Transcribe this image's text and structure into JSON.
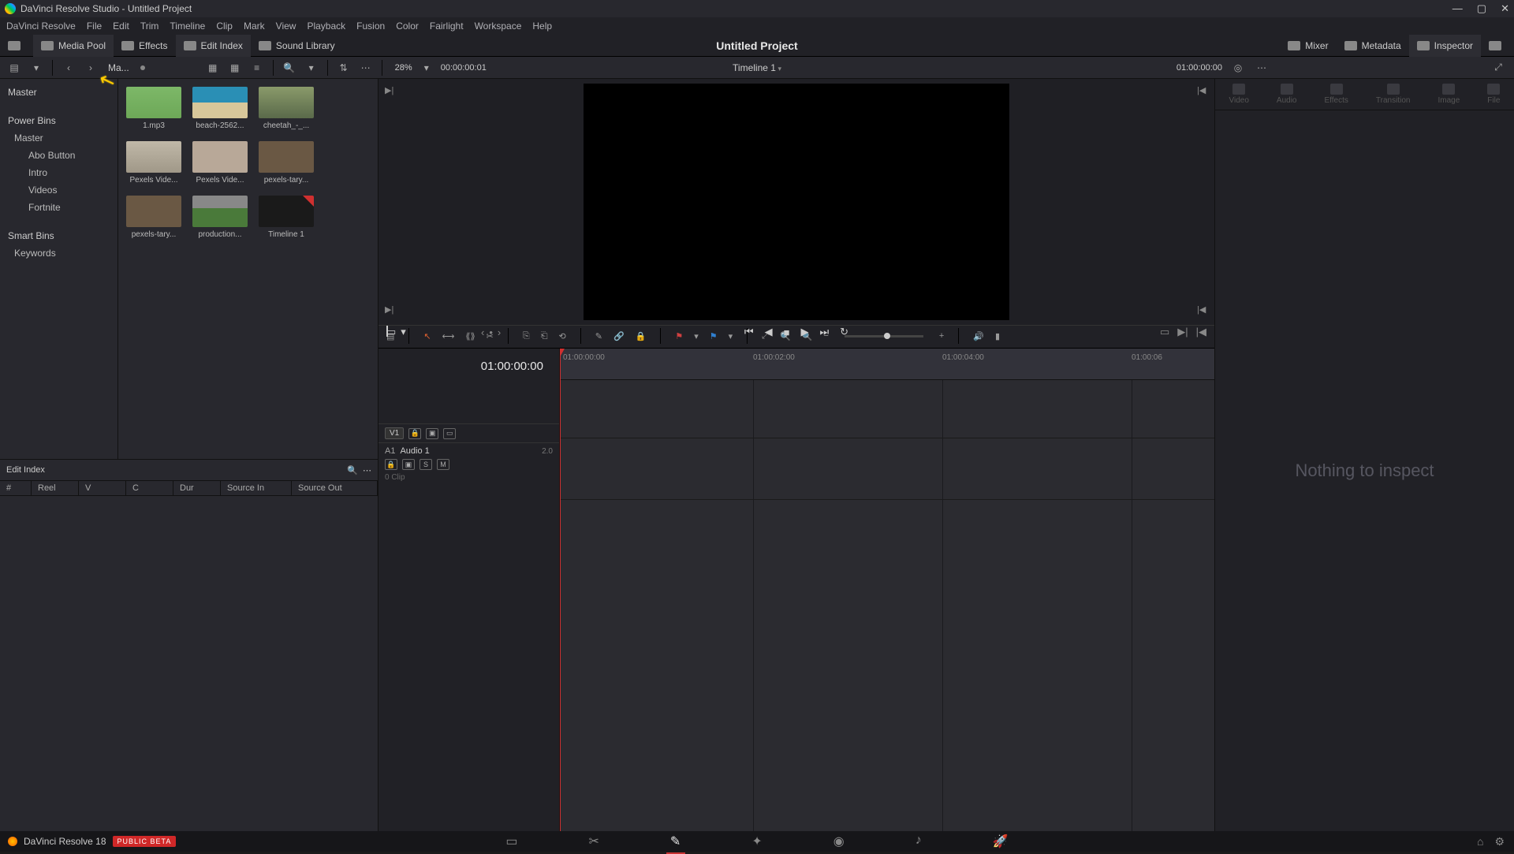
{
  "titlebar": {
    "text": "DaVinci Resolve Studio - Untitled Project"
  },
  "menubar": [
    "DaVinci Resolve",
    "File",
    "Edit",
    "Trim",
    "Timeline",
    "Clip",
    "Mark",
    "View",
    "Playback",
    "Fusion",
    "Color",
    "Fairlight",
    "Workspace",
    "Help"
  ],
  "toolbar": {
    "mediaPool": "Media Pool",
    "effects": "Effects",
    "editIndex": "Edit Index",
    "soundLibrary": "Sound Library",
    "projectTitle": "Untitled Project",
    "mixer": "Mixer",
    "metadata": "Metadata",
    "inspector": "Inspector"
  },
  "secbar": {
    "crumb": "Ma...",
    "zoomPct": "28%",
    "tcLeft": "00:00:00:01",
    "timelineName": "Timeline 1",
    "tcRight": "01:00:00:00"
  },
  "bins": {
    "root": "Master",
    "powerHeader": "Power Bins",
    "power": [
      "Master",
      "Abo Button",
      "Intro",
      "Videos",
      "Fortnite"
    ],
    "smartHeader": "Smart Bins",
    "smart": [
      "Keywords"
    ]
  },
  "clips": [
    {
      "label": "1.mp3",
      "kind": "wave"
    },
    {
      "label": "beach-2562...",
      "kind": "beach"
    },
    {
      "label": "cheetah_-_...",
      "kind": "forest"
    },
    {
      "label": "Pexels Vide...",
      "kind": "still"
    },
    {
      "label": "Pexels Vide...",
      "kind": "people"
    },
    {
      "label": "pexels-tary...",
      "kind": "brown"
    },
    {
      "label": "pexels-tary...",
      "kind": "brown"
    },
    {
      "label": "production...",
      "kind": "green"
    },
    {
      "label": "Timeline 1",
      "kind": "tl"
    }
  ],
  "timeline": {
    "tc": "01:00:00:00",
    "v1": "V1",
    "a1": "A1",
    "a1label": "Audio 1",
    "a1ch": "2.0",
    "a1clips": "0 Clip",
    "ticks": [
      "01:00:00:00",
      "01:00:02:00",
      "01:00:04:00",
      "01:00:06"
    ]
  },
  "editIndex": {
    "label": "Edit Index",
    "cols": [
      "#",
      "Reel",
      "V",
      "C",
      "Dur",
      "Source In",
      "Source Out"
    ]
  },
  "inspector": {
    "tabs": [
      "Video",
      "Audio",
      "Effects",
      "Transition",
      "Image",
      "File"
    ],
    "nothing": "Nothing to inspect"
  },
  "pagebar": {
    "app": "DaVinci Resolve 18",
    "beta": "PUBLIC BETA"
  }
}
